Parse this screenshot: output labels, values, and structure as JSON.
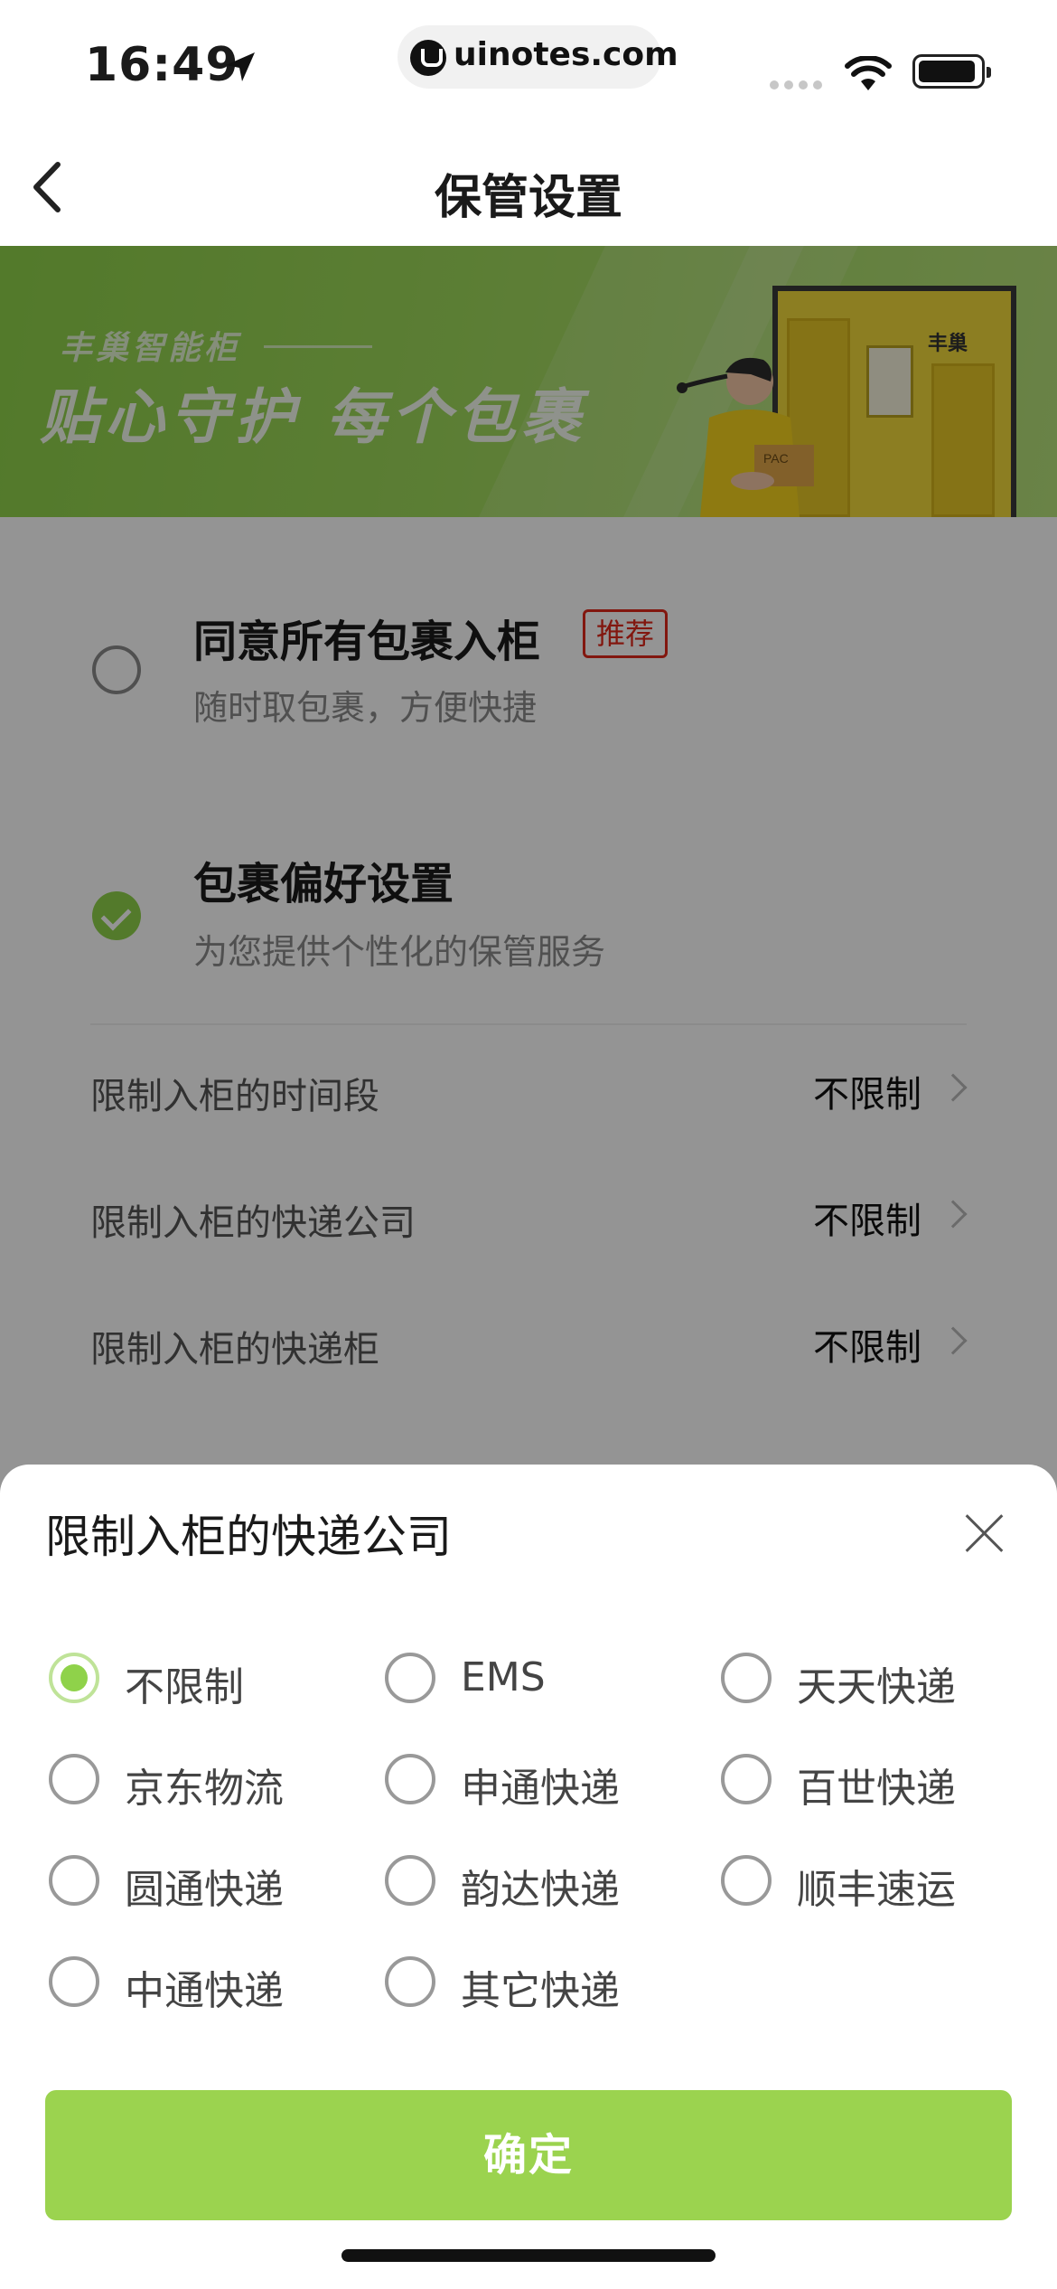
{
  "status_bar": {
    "time": "16:49",
    "url": "uinotes.com"
  },
  "nav": {
    "title": "保管设置"
  },
  "banner": {
    "subtitle": "丰巢智能柜",
    "headline": "贴心守护 每个包裹",
    "locker_brand": "丰巢",
    "box_label": "PAC"
  },
  "options_card": {
    "all_in": {
      "title": "同意所有包裹入柜",
      "badge": "推荐",
      "desc": "随时取包裹，方便快捷",
      "checked": false
    },
    "preference": {
      "title": "包裹偏好设置",
      "desc": "为您提供个性化的保管服务",
      "checked": true
    },
    "rows": [
      {
        "label": "限制入柜的时间段",
        "value": "不限制"
      },
      {
        "label": "限制入柜的快递公司",
        "value": "不限制"
      },
      {
        "label": "限制入柜的快递柜",
        "value": "不限制"
      }
    ]
  },
  "sheet": {
    "title": "限制入柜的快递公司",
    "options": [
      {
        "label": "不限制",
        "selected": true
      },
      {
        "label": "EMS",
        "selected": false
      },
      {
        "label": "天天快递",
        "selected": false
      },
      {
        "label": "京东物流",
        "selected": false
      },
      {
        "label": "申通快递",
        "selected": false
      },
      {
        "label": "百世快递",
        "selected": false
      },
      {
        "label": "圆通快递",
        "selected": false
      },
      {
        "label": "韵达快递",
        "selected": false
      },
      {
        "label": "顺丰速运",
        "selected": false
      },
      {
        "label": "中通快递",
        "selected": false
      },
      {
        "label": "其它快递",
        "selected": false
      }
    ],
    "confirm_label": "确定"
  },
  "colors": {
    "accent": "#8fd24a",
    "confirm_bg": "#9bd34f",
    "badge_red": "#e0281a"
  }
}
